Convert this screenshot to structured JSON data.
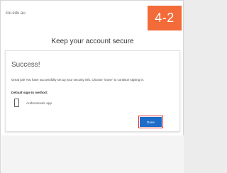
{
  "header": {
    "domain": "koi.edu.au",
    "step_badge": "4-2"
  },
  "page": {
    "title": "Keep your account secure"
  },
  "card": {
    "title": "Success!",
    "message": "Great job! You have successfully set up your security info. Choose \"Done\" to continue signing in.",
    "default_label": "Default sign-in method:",
    "method_icon": "phone-icon",
    "method_label": "Authenticator app",
    "done_label": "Done"
  },
  "colors": {
    "badge": "#f26b38",
    "button": "#1d6cc9",
    "highlight": "#e03131"
  }
}
